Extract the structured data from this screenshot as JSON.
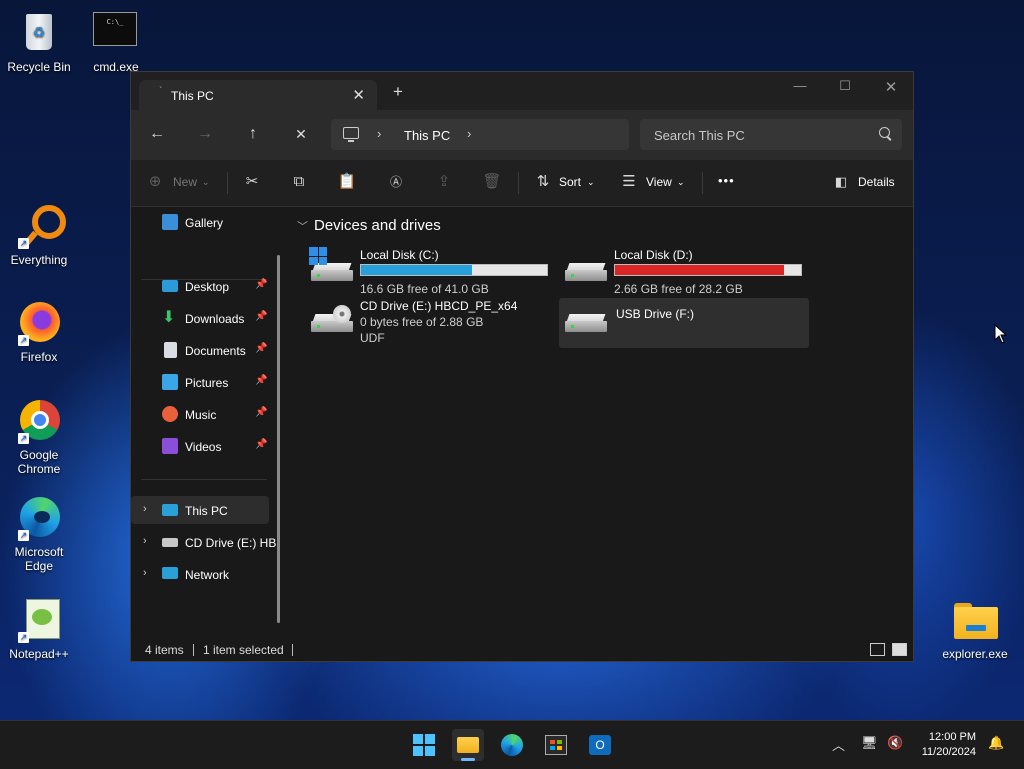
{
  "desktop": {
    "icons": [
      {
        "label": "Recycle Bin"
      },
      {
        "label": "cmd.exe"
      },
      {
        "label": "Everything"
      },
      {
        "label": "Firefox"
      },
      {
        "label": "Google Chrome"
      },
      {
        "label": "Microsoft Edge"
      },
      {
        "label": "Notepad++"
      },
      {
        "label": "explorer.exe"
      }
    ],
    "cmd_icon_text": "C:\\_"
  },
  "window": {
    "tab_title": "This PC",
    "address": {
      "crumb": "This PC"
    },
    "search_placeholder": "Search This PC",
    "commands": {
      "new": "New",
      "sort": "Sort",
      "view": "View",
      "more": "•••",
      "details": "Details"
    },
    "sidebar": {
      "gallery": "Gallery",
      "pinned": [
        {
          "label": "Desktop"
        },
        {
          "label": "Downloads"
        },
        {
          "label": "Documents"
        },
        {
          "label": "Pictures"
        },
        {
          "label": "Music"
        },
        {
          "label": "Videos"
        }
      ],
      "tree": [
        {
          "label": "This PC"
        },
        {
          "label": "CD Drive (E:) HB"
        },
        {
          "label": "Network"
        }
      ]
    },
    "content": {
      "group_header": "Devices and drives",
      "drives": [
        {
          "name": "Local Disk (C:)",
          "free": "16.6 GB free of 41.0 GB",
          "used_fraction": 0.595,
          "bar_color": "#26a0da"
        },
        {
          "name": "Local Disk (D:)",
          "free": "2.66 GB free of 28.2 GB",
          "used_fraction": 0.906,
          "bar_color": "#da2626"
        },
        {
          "name": "CD Drive (E:) HBCD_PE_x64",
          "free": "0 bytes free of 2.88 GB",
          "fs": "UDF"
        },
        {
          "name": "USB Drive (F:)"
        }
      ]
    },
    "status": {
      "items": "4 items",
      "selected": "1 item selected"
    }
  },
  "taskbar": {
    "time": "12:00 PM",
    "date": "11/20/2024"
  }
}
